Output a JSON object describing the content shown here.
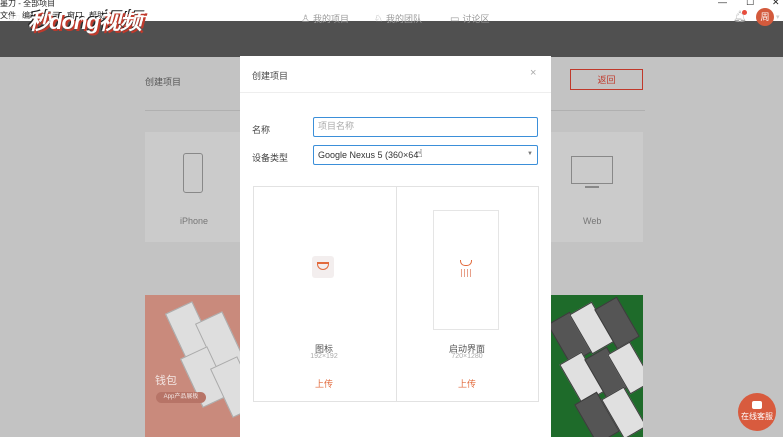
{
  "window": {
    "title": "墨刀 - 全部项目",
    "controls": [
      "—",
      "☐",
      "✕"
    ]
  },
  "menu": {
    "items": [
      "文件",
      "编辑",
      "显示",
      "窗口",
      "帮助"
    ]
  },
  "header": {
    "app_small": "墨刀",
    "brand": "秒dong视频",
    "nav": [
      {
        "label": "我的项目",
        "icon": "user-icon"
      },
      {
        "label": "我的团队",
        "icon": "team-icon"
      },
      {
        "label": "讨论区",
        "icon": "chat-icon"
      }
    ],
    "avatar_text": "周"
  },
  "page": {
    "title": "创建项目",
    "back_label": "返回",
    "cards": {
      "iphone": "iPhone",
      "web": "Web"
    },
    "wallet": {
      "name": "钱包",
      "tag": "App产品展板"
    },
    "chat_label": "在线客服"
  },
  "modal": {
    "title": "创建项目",
    "close": "×",
    "name_label": "名称",
    "name_placeholder": "项目名称",
    "device_label": "设备类型",
    "device_value": "Google Nexus 5 (360×64",
    "icon_upload": {
      "name": "图标",
      "size": "192×192",
      "action": "上传"
    },
    "splash_upload": {
      "name": "启动界面",
      "size": "720×1280",
      "action": "上传"
    }
  },
  "colors": {
    "accent": "#e26a3c",
    "focus": "#3b8fd9",
    "header": "#505050"
  }
}
